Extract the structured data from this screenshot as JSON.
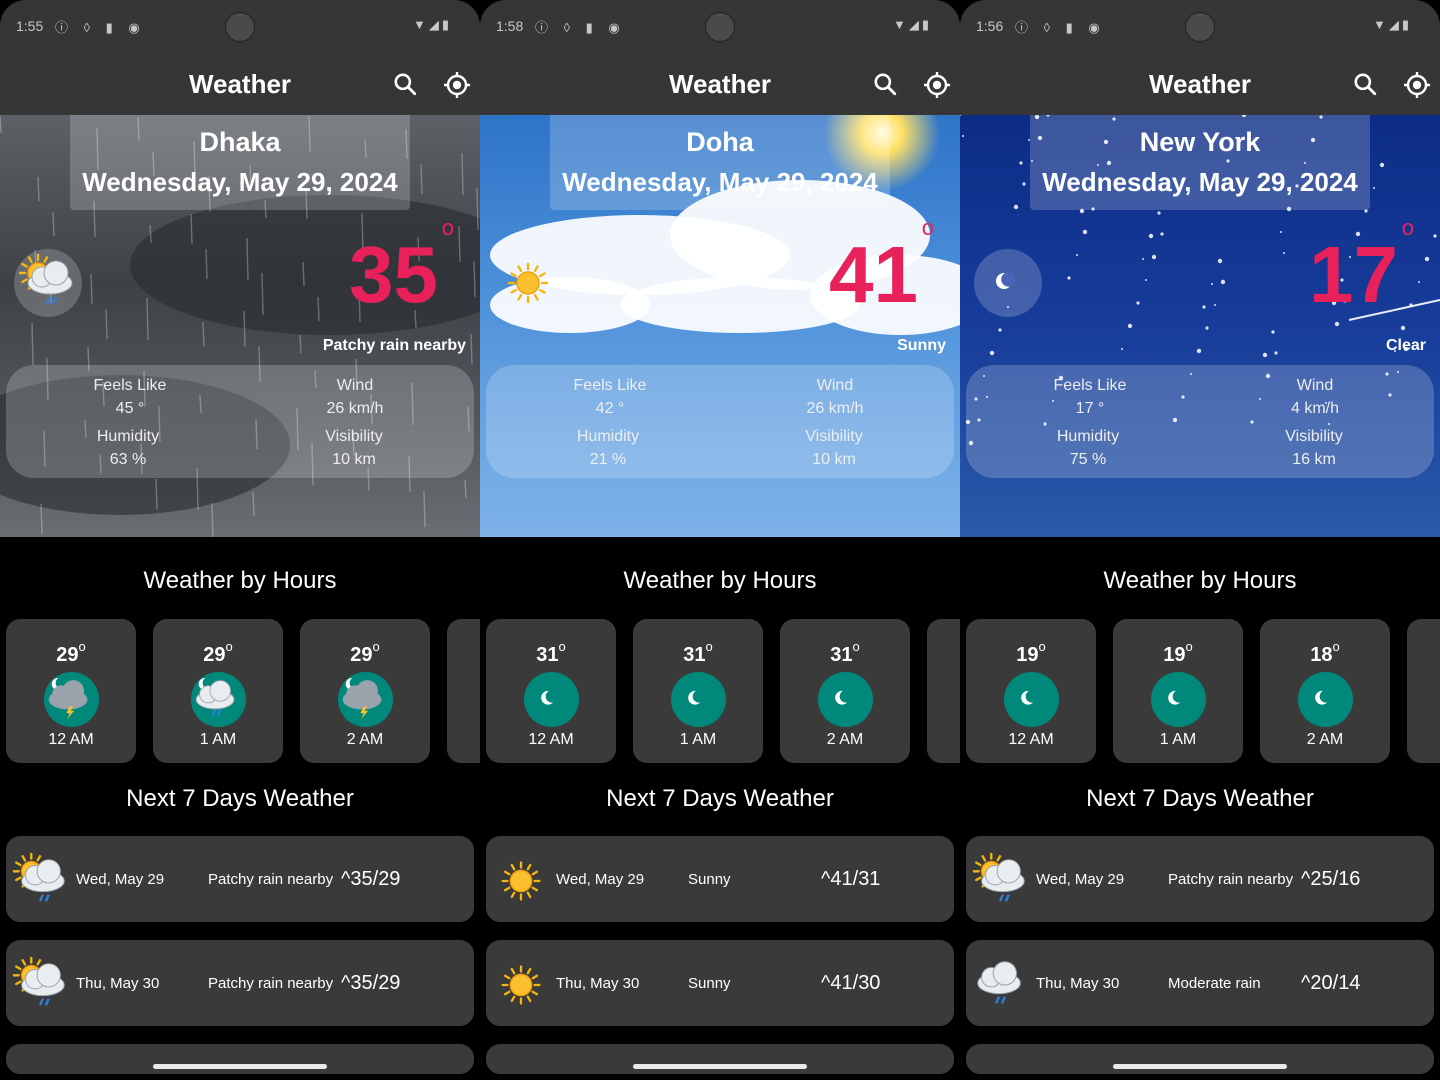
{
  "screens": [
    {
      "status_time": "1:55",
      "app_title": "Weather",
      "city": "Dhaka",
      "date": "Wednesday, May 29, 2024",
      "temp": "35",
      "deg": "o",
      "condition": "Patchy rain nearby",
      "theme": "rain",
      "condition_icon": "sun-cloud-rain-icon",
      "stats": {
        "feels_label": "Feels Like",
        "feels_value": "45 °",
        "wind_label": "Wind",
        "wind_value": "26 km/h",
        "humidity_label": "Humidity",
        "humidity_value": "63 %",
        "visibility_label": "Visibility",
        "visibility_value": "10 km"
      },
      "hours_title": "Weather by Hours",
      "hours": [
        {
          "temp": "29",
          "deg": "o",
          "time": "12 AM",
          "icon": "moon-cloud-storm-icon"
        },
        {
          "temp": "29",
          "deg": "o",
          "time": "1 AM",
          "icon": "moon-cloud-rain-icon"
        },
        {
          "temp": "29",
          "deg": "o",
          "time": "2 AM",
          "icon": "moon-cloud-storm-icon"
        }
      ],
      "days_title": "Next 7 Days Weather",
      "days": [
        {
          "date": "Wed, May 29",
          "cond": "Patchy rain nearby",
          "temps": "^35/29",
          "icon": "sun-cloud-rain-icon"
        },
        {
          "date": "Thu, May 30",
          "cond": "Patchy rain nearby",
          "temps": "^35/29",
          "icon": "sun-cloud-rain-icon"
        }
      ]
    },
    {
      "status_time": "1:58",
      "app_title": "Weather",
      "city": "Doha",
      "date": "Wednesday, May 29, 2024",
      "temp": "41",
      "deg": "o",
      "condition": "Sunny",
      "theme": "sunny",
      "condition_icon": "sun-icon",
      "stats": {
        "feels_label": "Feels Like",
        "feels_value": "42 °",
        "wind_label": "Wind",
        "wind_value": "26 km/h",
        "humidity_label": "Humidity",
        "humidity_value": "21 %",
        "visibility_label": "Visibility",
        "visibility_value": "10 km"
      },
      "hours_title": "Weather by Hours",
      "hours": [
        {
          "temp": "31",
          "deg": "o",
          "time": "12 AM",
          "icon": "moon-icon"
        },
        {
          "temp": "31",
          "deg": "o",
          "time": "1 AM",
          "icon": "moon-icon"
        },
        {
          "temp": "31",
          "deg": "o",
          "time": "2 AM",
          "icon": "moon-icon"
        }
      ],
      "days_title": "Next 7 Days Weather",
      "days": [
        {
          "date": "Wed, May 29",
          "cond": "Sunny",
          "temps": "^41/31",
          "icon": "sun-icon"
        },
        {
          "date": "Thu, May 30",
          "cond": "Sunny",
          "temps": "^41/30",
          "icon": "sun-icon"
        }
      ]
    },
    {
      "status_time": "1:56",
      "app_title": "Weather",
      "city": "New York",
      "date": "Wednesday, May 29, 2024",
      "temp": "17",
      "deg": "o",
      "condition": "Clear",
      "theme": "clear",
      "condition_icon": "moon-icon",
      "stats": {
        "feels_label": "Feels Like",
        "feels_value": "17 °",
        "wind_label": "Wind",
        "wind_value": "4 km/h",
        "humidity_label": "Humidity",
        "humidity_value": "75 %",
        "visibility_label": "Visibility",
        "visibility_value": "16 km"
      },
      "hours_title": "Weather by Hours",
      "hours": [
        {
          "temp": "19",
          "deg": "o",
          "time": "12 AM",
          "icon": "moon-icon"
        },
        {
          "temp": "19",
          "deg": "o",
          "time": "1 AM",
          "icon": "moon-icon"
        },
        {
          "temp": "18",
          "deg": "o",
          "time": "2 AM",
          "icon": "moon-icon"
        }
      ],
      "days_title": "Next 7 Days Weather",
      "days": [
        {
          "date": "Wed, May 29",
          "cond": "Patchy rain nearby",
          "temps": "^25/16",
          "icon": "sun-cloud-rain-icon"
        },
        {
          "date": "Thu, May 30",
          "cond": "Moderate rain",
          "temps": "^20/14",
          "icon": "cloud-rain-icon"
        }
      ]
    }
  ],
  "colors": {
    "temperature": "#e8215a",
    "hour_icon_bg": "#00897b",
    "card_bg": "#3a3a3a",
    "appbar_bg": "#363636"
  }
}
